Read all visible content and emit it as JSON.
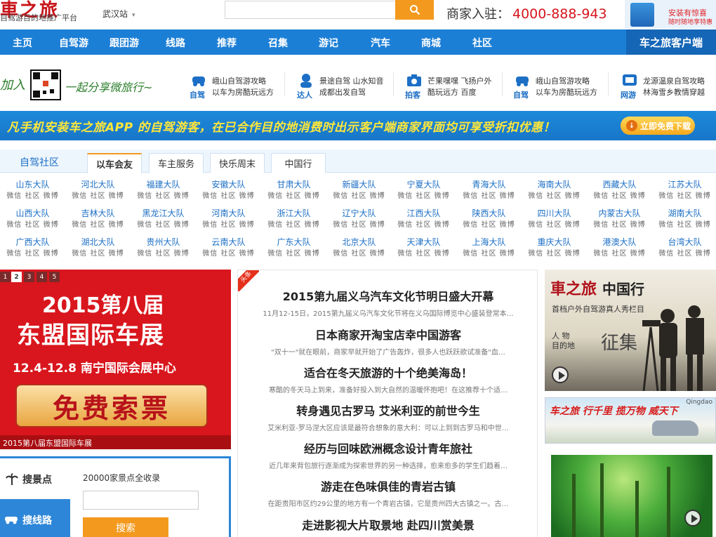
{
  "header": {
    "logo": "車之旅",
    "slogan": "自驾游目的地推广平台",
    "city": "武汉站",
    "merchant_label": "商家入驻：",
    "merchant_phone": "4000-888-943",
    "app_promo_line1": "安装有惊喜",
    "app_promo_line2": "随时随地享特惠"
  },
  "nav": {
    "items": [
      "主页",
      "自驾游",
      "跟团游",
      "线路",
      "推荐",
      "召集",
      "游记",
      "汽车",
      "商城",
      "社区"
    ],
    "app": "车之旅客户端"
  },
  "promo": {
    "wechat_left": "加入",
    "wechat_right": "一起分享微旅行~",
    "items": [
      {
        "tag": "自驾",
        "line1": "峨山自驾游攻略",
        "line2": "以车为房酷玩远方"
      },
      {
        "tag": "达人",
        "line1": "景途自驾 山水知音",
        "line2": "成都出发自驾"
      },
      {
        "tag": "拍客",
        "line1": "芒果嘿嘿 飞扬户外",
        "line2": "酷玩远方 百度"
      },
      {
        "tag": "自驾",
        "line1": "峨山自驾游攻略",
        "line2": "以车为房酷玩远方"
      },
      {
        "tag": "网游",
        "line1": "龙源温泉自驾攻略",
        "line2": "林海雪乡教情穿越"
      }
    ]
  },
  "banner": {
    "text": "凡手机安装车之旅APP 的自驾游客，在已合作目的地消费时出示客户端商家界面均可享受折扣优惠！",
    "download": "立即免费下载"
  },
  "community": {
    "title": "自驾社区",
    "tabs": [
      "以车会友",
      "车主服务",
      "快乐周末",
      "中国行"
    ],
    "links": "微信 社区 微博",
    "teams": [
      "山东大队",
      "河北大队",
      "福建大队",
      "安徽大队",
      "甘肃大队",
      "新疆大队",
      "宁夏大队",
      "青海大队",
      "海南大队",
      "西藏大队",
      "江苏大队",
      "山西大队",
      "吉林大队",
      "黑龙江大队",
      "河南大队",
      "浙江大队",
      "辽宁大队",
      "江西大队",
      "陕西大队",
      "四川大队",
      "内蒙古大队",
      "湖南大队",
      "广西大队",
      "湖北大队",
      "贵州大队",
      "云南大队",
      "广东大队",
      "北京大队",
      "天津大队",
      "上海大队",
      "重庆大队",
      "港澳大队",
      "台湾大队"
    ]
  },
  "slider": {
    "pages": [
      "1",
      "2",
      "3",
      "4",
      "5"
    ],
    "active_page": "2",
    "line1": "2015第八届",
    "line2": "东盟国际车展",
    "line3": "12.4-12.8 南宁国际会展中心",
    "ticket": "免费索票",
    "caption": "2015第八届东盟国际车展"
  },
  "search_panel": {
    "tab1": "搜景点",
    "tab2": "搜线路",
    "note": "20000家景点全收录",
    "input_value": "",
    "button": "搜索"
  },
  "news": {
    "corner": "头条",
    "items": [
      {
        "title": "2015第九届义乌汽车文化节明日盛大开幕",
        "summary": "11月12-15日，2015第九届义乌汽车文化节将在义乌国际博览中心盛装登常本…"
      },
      {
        "title": "日本商家开淘宝店幸中国游客",
        "summary": "\"双十一\"就在眼前，商家早就开始了广告轰炸，很多人也跃跃欲试准备\"血…"
      },
      {
        "title": "适合在冬天旅游的十个绝美海岛！",
        "summary": "寒酷的冬天马上到来，准备好投入到大自然的温暖怀抱吧！在这推荐十个适…"
      },
      {
        "title": "转身遇见古罗马 艾米利亚的前世今生",
        "summary": "艾米利亚-罗马涅大区应该是最符合想象的意大利：可以上到到古罗马和中世…"
      },
      {
        "title": "经历与回味欧洲概念设计青年旅社",
        "summary": "近几年来背包旅行逐渐成为探索世界的另一种选择，愈来愈多的学生们趋着…"
      },
      {
        "title": "游走在色味俱佳的青岩古镇",
        "summary": "在距贵阳市区约29公里的地方有一个青岩古镇，它是贵州四大古镇之一。古…"
      },
      {
        "title": "走进影视大片取景地 赴四川赏美景",
        "summary": ""
      }
    ]
  },
  "ads": {
    "ad1_brand": "車之旅",
    "ad1_brand2": "中国行",
    "ad1_sub": "首档户外自驾游真人秀栏目",
    "ad1_r1": "人 物",
    "ad1_r2": "目的地",
    "ad1_zj": "征集",
    "ad2_text": "车之旅 行千里 揽万物 威天下",
    "ad2_qd": "Qingdao"
  }
}
